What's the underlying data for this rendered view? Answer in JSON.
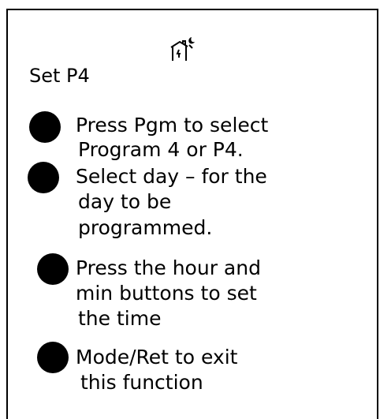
{
  "header": {
    "title": "Set P4",
    "icon": "house-night-icon"
  },
  "steps": [
    {
      "lines": [
        "Press Pgm to select",
        "Program 4 or P4."
      ]
    },
    {
      "lines": [
        "Select day – for the",
        "day to be",
        "programmed."
      ]
    },
    {
      "lines": [
        "Press the hour and",
        "min buttons to set",
        "the time"
      ]
    },
    {
      "lines": [
        "Mode/Ret to exit",
        "this function"
      ]
    }
  ]
}
